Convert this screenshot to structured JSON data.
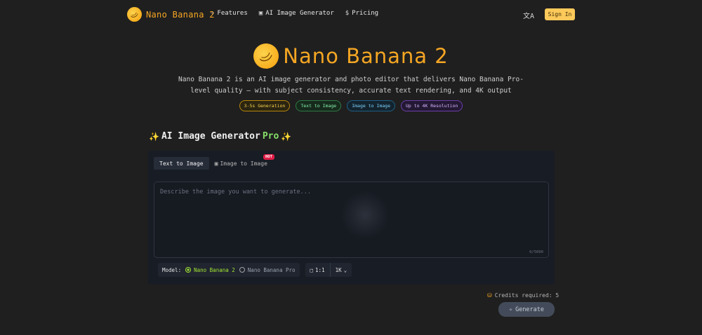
{
  "nav": {
    "brand": "Nano Banana 2",
    "links": [
      {
        "label": "Features",
        "icon": "sparkles-icon"
      },
      {
        "label": "AI Image Generator",
        "icon": "image-icon"
      },
      {
        "label": "Pricing",
        "icon": "dollar-icon"
      }
    ],
    "translate_icon": "translate-icon",
    "signin": "Sign In"
  },
  "hero": {
    "title": "Nano Banana 2",
    "subtitle": "Nano Banana 2 is an AI image generator and photo editor that delivers Nano Banana Pro-level quality — with subject consistency, accurate text rendering, and 4K output",
    "pills": [
      "3-5s Generation",
      "Text to Image",
      "Image to Image",
      "Up to 4K Resolution"
    ]
  },
  "generator": {
    "title": "AI Image Generator",
    "title_pro": "Pro",
    "tabs": {
      "text_to_image": "Text to Image",
      "image_to_image": "Image to Image",
      "hot": "HOT"
    },
    "prompt_placeholder": "Describe the image you want to generate...",
    "counter": "0/5000",
    "model_label": "Model:",
    "models": [
      "Nano Banana 2",
      "Nano Banana Pro"
    ],
    "selected_model": "Nano Banana 2",
    "aspect": "1:1",
    "resolution": "1K",
    "credits": "Credits required: 5",
    "generate": "Generate"
  },
  "colors": {
    "accent": "#f5a623",
    "signin_bg": "#fcc95a",
    "selected_model": "#a3e635",
    "pro": "#86e06a"
  }
}
